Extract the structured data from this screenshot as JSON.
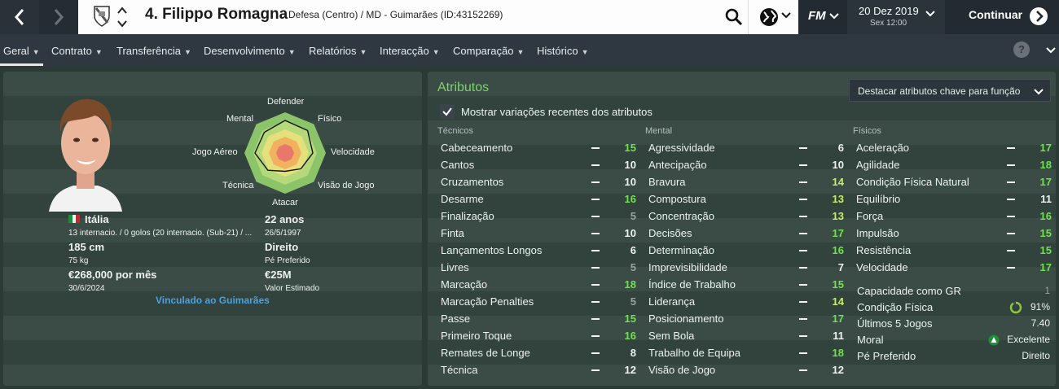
{
  "header": {
    "player_title": "4. Filippo Romagna",
    "player_subtitle": "Defesa (Centro) / MD - Guimarães (ID:43152269)",
    "fm_logo": "FM",
    "date": "20 Dez 2019",
    "day": "Sex 12:00",
    "continue_label": "Continuar"
  },
  "menu": {
    "items": [
      {
        "label": "Geral"
      },
      {
        "label": "Contrato"
      },
      {
        "label": "Transferência"
      },
      {
        "label": "Desenvolvimento"
      },
      {
        "label": "Relatórios"
      },
      {
        "label": "Interacção"
      },
      {
        "label": "Comparação"
      },
      {
        "label": "Histórico"
      }
    ],
    "help": "?"
  },
  "profile": {
    "nationality": "Itália",
    "caps": "13 internacio. / 0 golos (20 internacio. (Sub-21) / ...",
    "height": "185 cm",
    "weight": "75 kg",
    "wage": "€268,000 por mês",
    "contract_end": "30/6/2024",
    "age": "22 anos",
    "dob": "26/5/1997",
    "foot": "Direito",
    "foot_label": "Pé Preferido",
    "value": "€25M",
    "value_label": "Valor Estimado",
    "club_link": "Vinculado ao Guimarães"
  },
  "radar": {
    "labels": {
      "defender": "Defender",
      "fisico": "Físico",
      "velocidade": "Velocidade",
      "visao": "Visão de Jogo",
      "atacar": "Atacar",
      "tecnica": "Técnica",
      "jogo_aereo": "Jogo Aéreo",
      "mental": "Mental"
    },
    "values": {
      "defender": 0.8,
      "fisico": 0.78,
      "velocidade": 0.68,
      "visao": 0.55,
      "atacar": 0.45,
      "tecnica": 0.6,
      "jogo_aereo": 0.74,
      "mental": 0.72
    }
  },
  "attributes": {
    "title": "Atributos",
    "highlight_button": "Destacar atributos chave para função",
    "show_changes_label": "Mostrar variações recentes dos atributos",
    "tecnicos": {
      "heading": "Técnicos",
      "items": [
        {
          "name": "Cabeceamento",
          "value": "15"
        },
        {
          "name": "Cantos",
          "value": "10"
        },
        {
          "name": "Cruzamentos",
          "value": "10"
        },
        {
          "name": "Desarme",
          "value": "16"
        },
        {
          "name": "Finalização",
          "value": "5"
        },
        {
          "name": "Finta",
          "value": "10"
        },
        {
          "name": "Lançamentos Longos",
          "value": "6"
        },
        {
          "name": "Livres",
          "value": "5"
        },
        {
          "name": "Marcação",
          "value": "18"
        },
        {
          "name": "Marcação Penalties",
          "value": "5"
        },
        {
          "name": "Passe",
          "value": "15"
        },
        {
          "name": "Primeiro Toque",
          "value": "16"
        },
        {
          "name": "Remates de Longe",
          "value": "8"
        },
        {
          "name": "Técnica",
          "value": "12"
        }
      ]
    },
    "mental": {
      "heading": "Mental",
      "items": [
        {
          "name": "Agressividade",
          "value": "6"
        },
        {
          "name": "Antecipação",
          "value": "10"
        },
        {
          "name": "Bravura",
          "value": "14"
        },
        {
          "name": "Compostura",
          "value": "13"
        },
        {
          "name": "Concentração",
          "value": "13"
        },
        {
          "name": "Decisões",
          "value": "17"
        },
        {
          "name": "Determinação",
          "value": "16"
        },
        {
          "name": "Imprevisibilidade",
          "value": "7"
        },
        {
          "name": "Índice de Trabalho",
          "value": "15"
        },
        {
          "name": "Liderança",
          "value": "14"
        },
        {
          "name": "Posicionamento",
          "value": "17"
        },
        {
          "name": "Sem Bola",
          "value": "11"
        },
        {
          "name": "Trabalho de Equipa",
          "value": "18"
        },
        {
          "name": "Visão de Jogo",
          "value": "12"
        }
      ]
    },
    "fisicos": {
      "heading": "Físicos",
      "items": [
        {
          "name": "Aceleração",
          "value": "17"
        },
        {
          "name": "Agilidade",
          "value": "18"
        },
        {
          "name": "Condição Física Natural",
          "value": "17"
        },
        {
          "name": "Equilíbrio",
          "value": "11"
        },
        {
          "name": "Força",
          "value": "16"
        },
        {
          "name": "Impulsão",
          "value": "15"
        },
        {
          "name": "Resistência",
          "value": "15"
        },
        {
          "name": "Velocidade",
          "value": "17"
        }
      ]
    },
    "info": [
      {
        "name": "Capacidade como GR",
        "value": "1"
      },
      {
        "name": "Condição Física",
        "value": "91%"
      },
      {
        "name": "Últimos 5 Jogos",
        "value": "7.40"
      },
      {
        "name": "Moral",
        "value": "Excelente"
      },
      {
        "name": "Pé Preferido",
        "value": "Direito"
      }
    ],
    "condition_fraction": 0.91
  },
  "colors": {
    "attr_high": "#6fe34d",
    "attr_good": "#c6f060",
    "attr_mid": "#eef1ef",
    "attr_low": "#9aa29f",
    "section_title": "#7fd06f",
    "link": "#4aa0e0"
  }
}
